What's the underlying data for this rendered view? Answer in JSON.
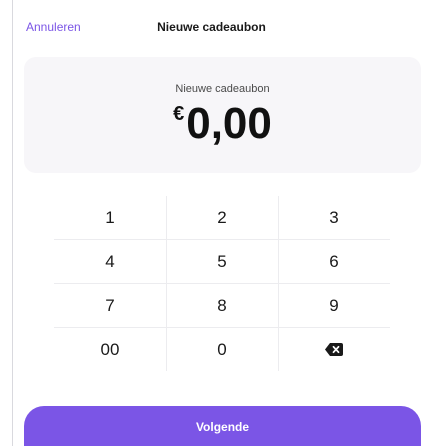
{
  "header": {
    "cancel_label": "Annuleren",
    "title": "Nieuwe cadeaubon"
  },
  "amount": {
    "label": "Nieuwe cadeaubon",
    "currency": "€",
    "value": "0,00"
  },
  "keypad": {
    "keys": [
      "1",
      "2",
      "3",
      "4",
      "5",
      "6",
      "7",
      "8",
      "9",
      "00",
      "0"
    ],
    "backspace_icon": "backspace-icon"
  },
  "footer": {
    "next_label": "Volgende"
  },
  "colors": {
    "accent": "#7b55e6",
    "card_background": "#f7f6f9",
    "divider": "#ececef"
  }
}
